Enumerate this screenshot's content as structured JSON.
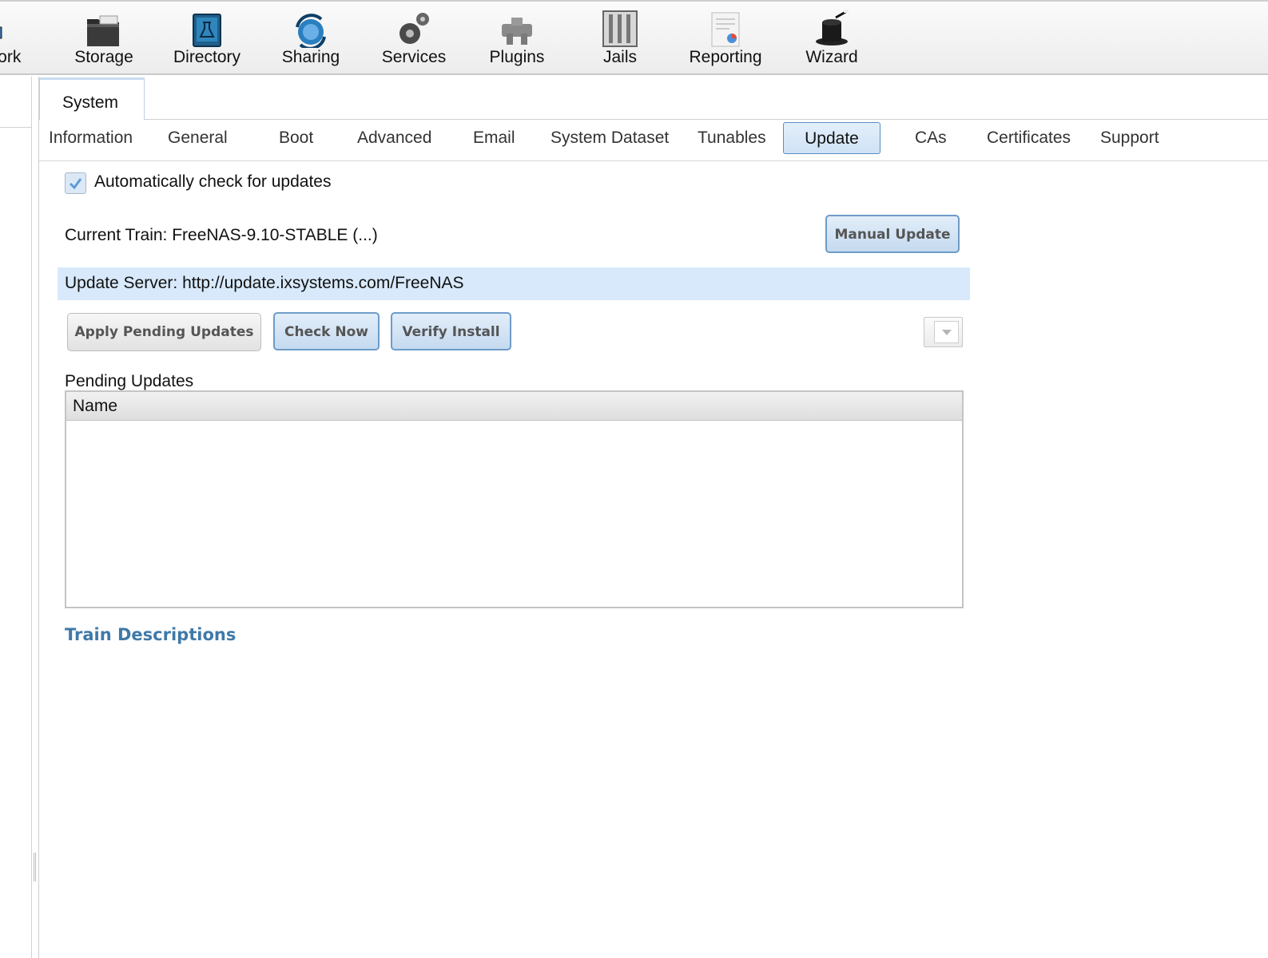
{
  "toolbar": {
    "items": [
      {
        "label": "work",
        "icon": "network-icon"
      },
      {
        "label": "Storage",
        "icon": "storage-icon"
      },
      {
        "label": "Directory",
        "icon": "directory-icon"
      },
      {
        "label": "Sharing",
        "icon": "sharing-icon"
      },
      {
        "label": "Services",
        "icon": "services-icon"
      },
      {
        "label": "Plugins",
        "icon": "plugins-icon"
      },
      {
        "label": "Jails",
        "icon": "jails-icon"
      },
      {
        "label": "Reporting",
        "icon": "reporting-icon"
      },
      {
        "label": "Wizard",
        "icon": "wizard-icon"
      }
    ]
  },
  "main_tab": {
    "label": "System"
  },
  "subtabs": {
    "items": [
      {
        "label": "Information"
      },
      {
        "label": "General"
      },
      {
        "label": "Boot"
      },
      {
        "label": "Advanced"
      },
      {
        "label": "Email"
      },
      {
        "label": "System Dataset"
      },
      {
        "label": "Tunables"
      },
      {
        "label": "Update"
      },
      {
        "label": "CAs"
      },
      {
        "label": "Certificates"
      },
      {
        "label": "Support"
      }
    ],
    "active": "Update"
  },
  "update": {
    "auto_check_label": "Automatically check for updates",
    "auto_check_checked": true,
    "current_train": "Current Train: FreeNAS-9.10-STABLE (...)",
    "manual_update_label": "Manual Update",
    "update_server": "Update Server: http://update.ixsystems.com/FreeNAS",
    "apply_pending_label": "Apply Pending Updates",
    "check_now_label": "Check Now",
    "verify_install_label": "Verify Install",
    "pending_updates_label": "Pending Updates",
    "grid_columns": [
      "Name"
    ],
    "grid_rows": [],
    "train_descriptions_label": "Train Descriptions"
  },
  "colors": {
    "accent_blue": "#5b8fc4",
    "selection_bg": "#d8e9fb",
    "link": "#3f79a8"
  }
}
